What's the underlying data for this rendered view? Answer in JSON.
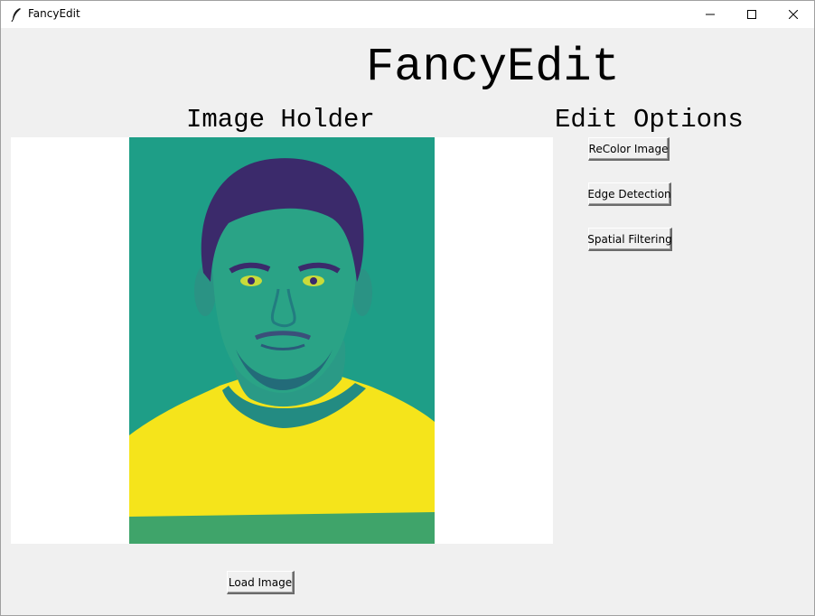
{
  "window": {
    "title": "FancyEdit",
    "controls": [
      "minimize-icon",
      "maximize-icon",
      "close-icon"
    ]
  },
  "headings": {
    "app_title": "FancyEdit",
    "image_holder": "Image Holder",
    "edit_options": "Edit Options"
  },
  "image_holder": {
    "image_description_colors": {
      "background": "#1e9e87",
      "shirt": "#f5e41b",
      "hair": "#3b2a6b"
    }
  },
  "edit_options": {
    "buttons": [
      "ReColor Image",
      "Edge Detection",
      "Spatial Filtering"
    ]
  },
  "actions": {
    "load_image": "Load Image"
  }
}
